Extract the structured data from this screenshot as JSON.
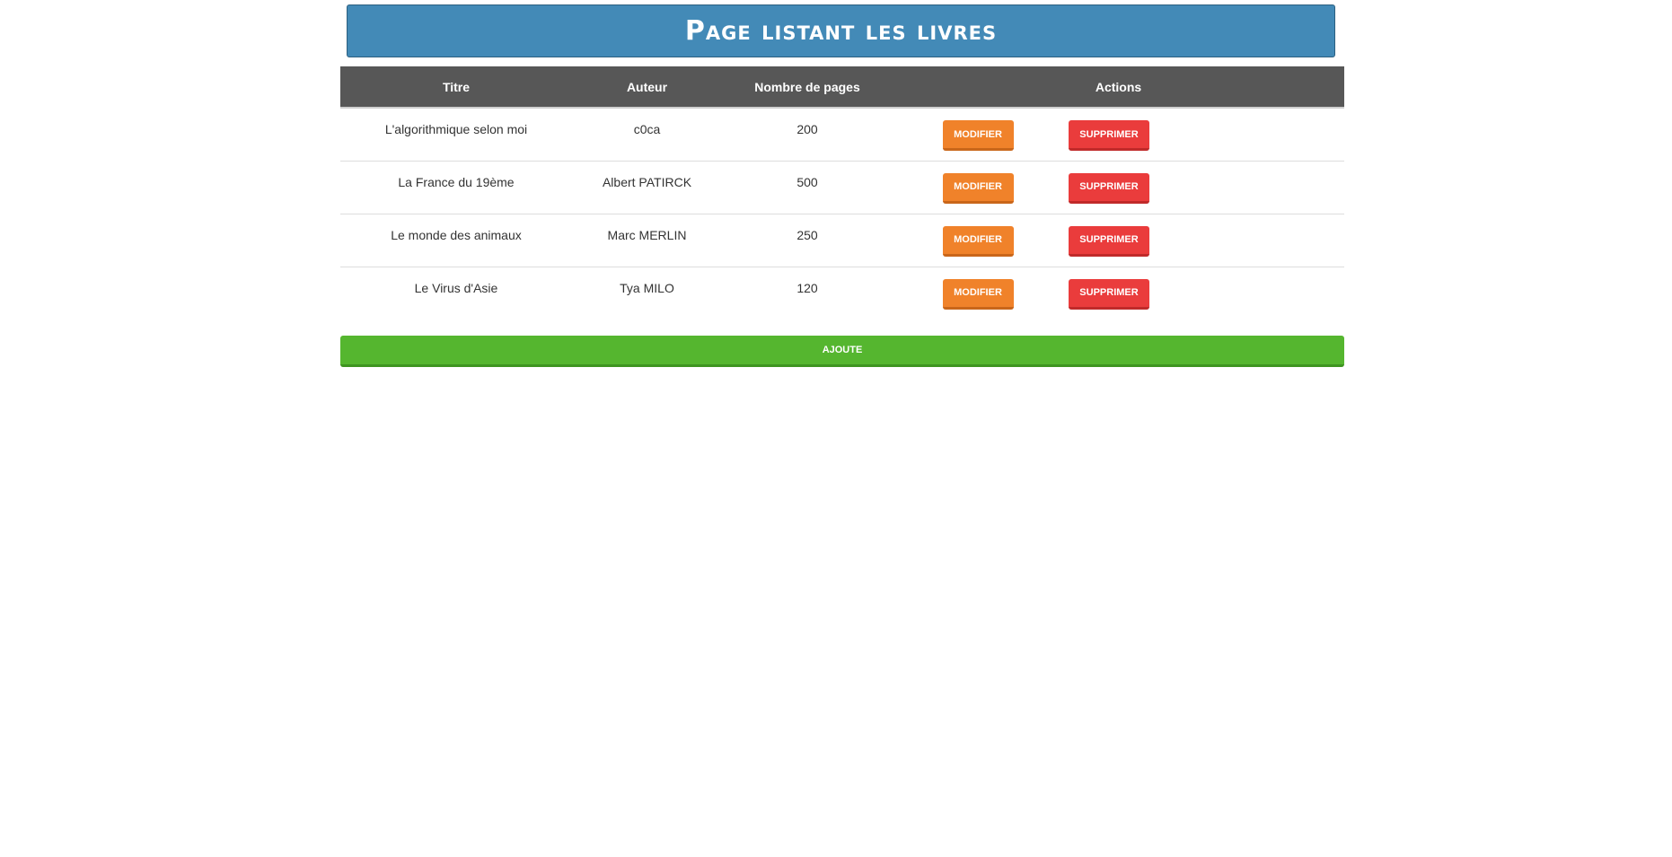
{
  "page": {
    "title": "Page listant les livres"
  },
  "table": {
    "headers": [
      "Titre",
      "Auteur",
      "Nombre de pages",
      "Actions"
    ],
    "rows": [
      {
        "titre": "L'algorithmique selon moi",
        "auteur": "c0ca",
        "pages": "200"
      },
      {
        "titre": "La France du 19ème",
        "auteur": "Albert PATIRCK",
        "pages": "500"
      },
      {
        "titre": "Le monde des animaux",
        "auteur": "Marc MERLIN",
        "pages": "250"
      },
      {
        "titre": "Le Virus d'Asie",
        "auteur": "Tya MILO",
        "pages": "120"
      }
    ]
  },
  "actions": {
    "edit_label": "MODIFIER",
    "delete_label": "SUPPRIMER",
    "add_label": "AJOUTE"
  },
  "colors": {
    "banner": "#438ab7",
    "header": "#575757",
    "edit": "#f0822a",
    "delete": "#ea3c3c",
    "add": "#55b62f"
  }
}
